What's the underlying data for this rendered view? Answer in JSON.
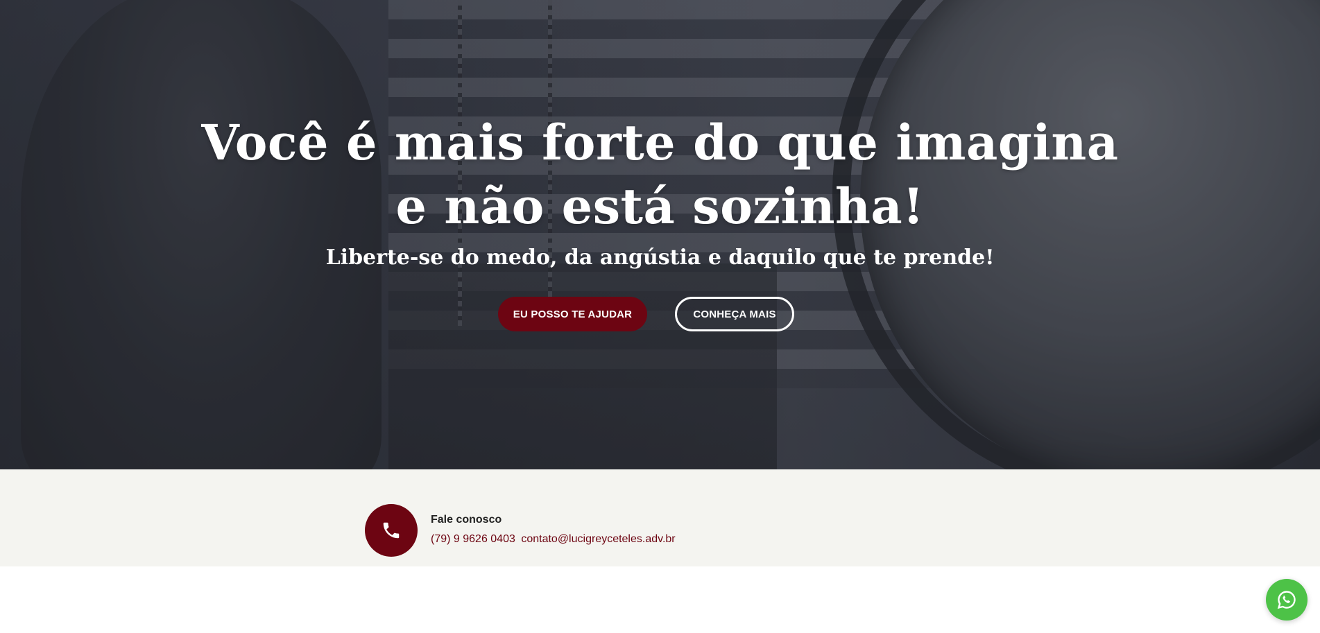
{
  "hero": {
    "title_line1": "Você é mais forte do que imagina",
    "title_line2": "e não está sozinha!",
    "subtitle": "Liberte-se do medo, da angústia e daquilo que te prende!",
    "primary_button": "EU POSSO TE AJUDAR",
    "secondary_button": "CONHEÇA MAIS",
    "primary_color": "#6d0512"
  },
  "contact": {
    "icon": "phone-icon",
    "label": "Fale conosco",
    "phone": "(79) 9 9626 0403",
    "email": "contato@lucigreyceteles.adv.br",
    "background": "#f4f4f0"
  },
  "floating": {
    "icon": "whatsapp-icon",
    "color": "#4dc247"
  }
}
